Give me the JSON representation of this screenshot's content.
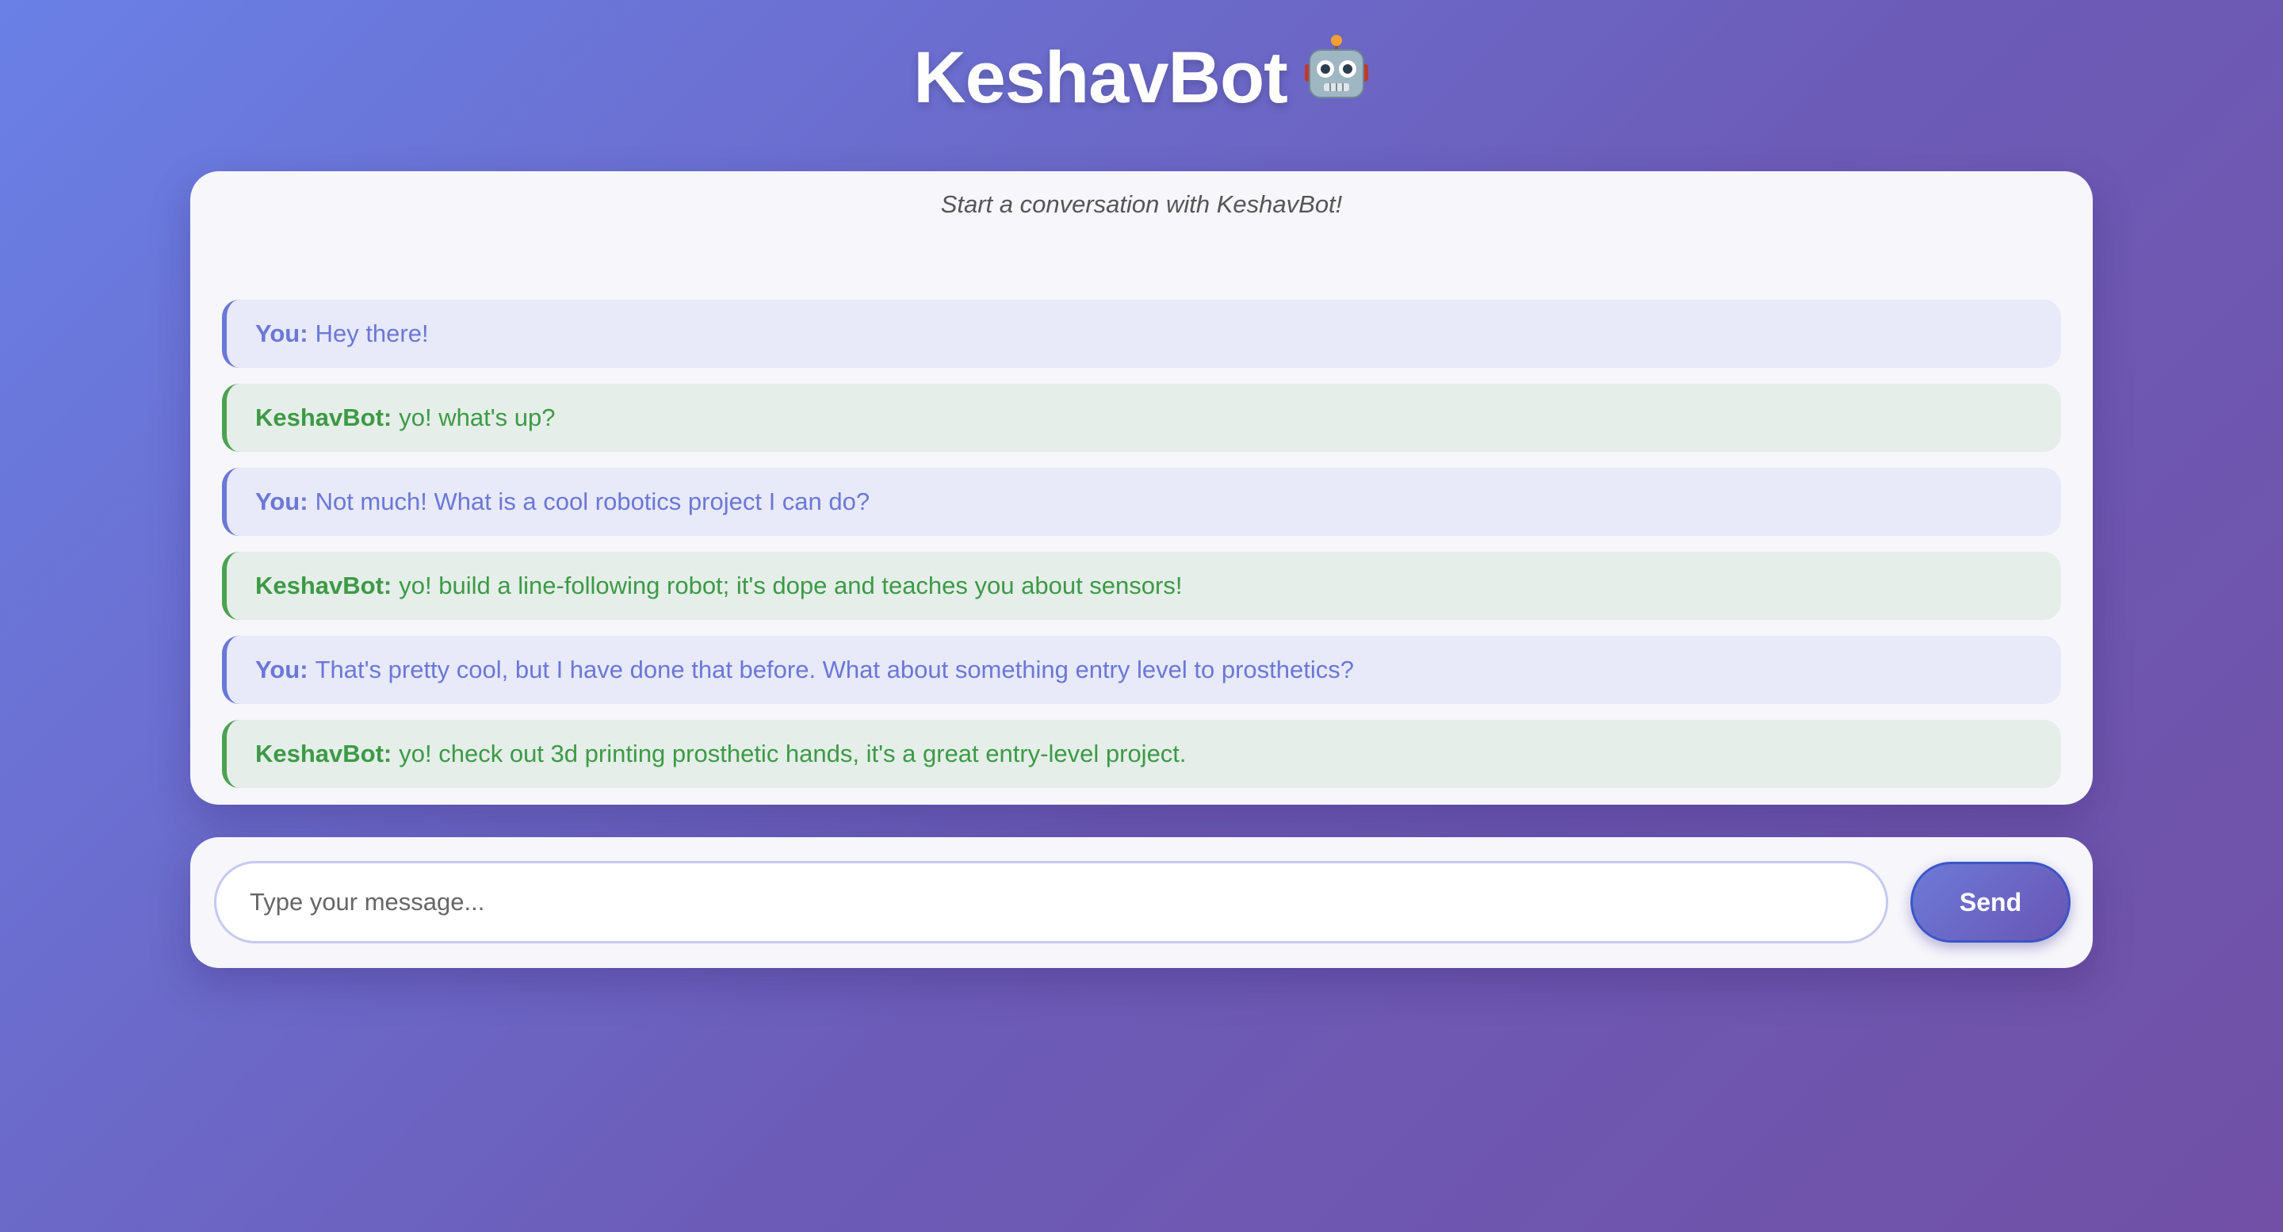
{
  "header": {
    "title": "KeshavBot",
    "icon": "robot-face-icon"
  },
  "chat": {
    "intro": "Start a conversation with KeshavBot!",
    "messages": [
      {
        "role": "user",
        "speaker": "You:",
        "text": "Hey there!"
      },
      {
        "role": "bot",
        "speaker": "KeshavBot:",
        "text": "yo! what's up?"
      },
      {
        "role": "user",
        "speaker": "You:",
        "text": "Not much! What is a cool robotics project I can do?"
      },
      {
        "role": "bot",
        "speaker": "KeshavBot:",
        "text": "yo! build a line-following robot; it's dope and teaches you about sensors!"
      },
      {
        "role": "user",
        "speaker": "You:",
        "text": "That's pretty cool, but I have done that before. What about something entry level to prosthetics?"
      },
      {
        "role": "bot",
        "speaker": "KeshavBot:",
        "text": "yo! check out 3d printing prosthetic hands, it's a great entry-level project."
      }
    ]
  },
  "composer": {
    "placeholder": "Type your message...",
    "value": "",
    "send_label": "Send"
  },
  "colors": {
    "user_accent": "#6a78d6",
    "bot_accent": "#4ca253",
    "user_bubble": "#e8e9f9",
    "bot_bubble": "#e5eee9",
    "background_start": "#6a80e6",
    "background_end": "#7150a6"
  }
}
